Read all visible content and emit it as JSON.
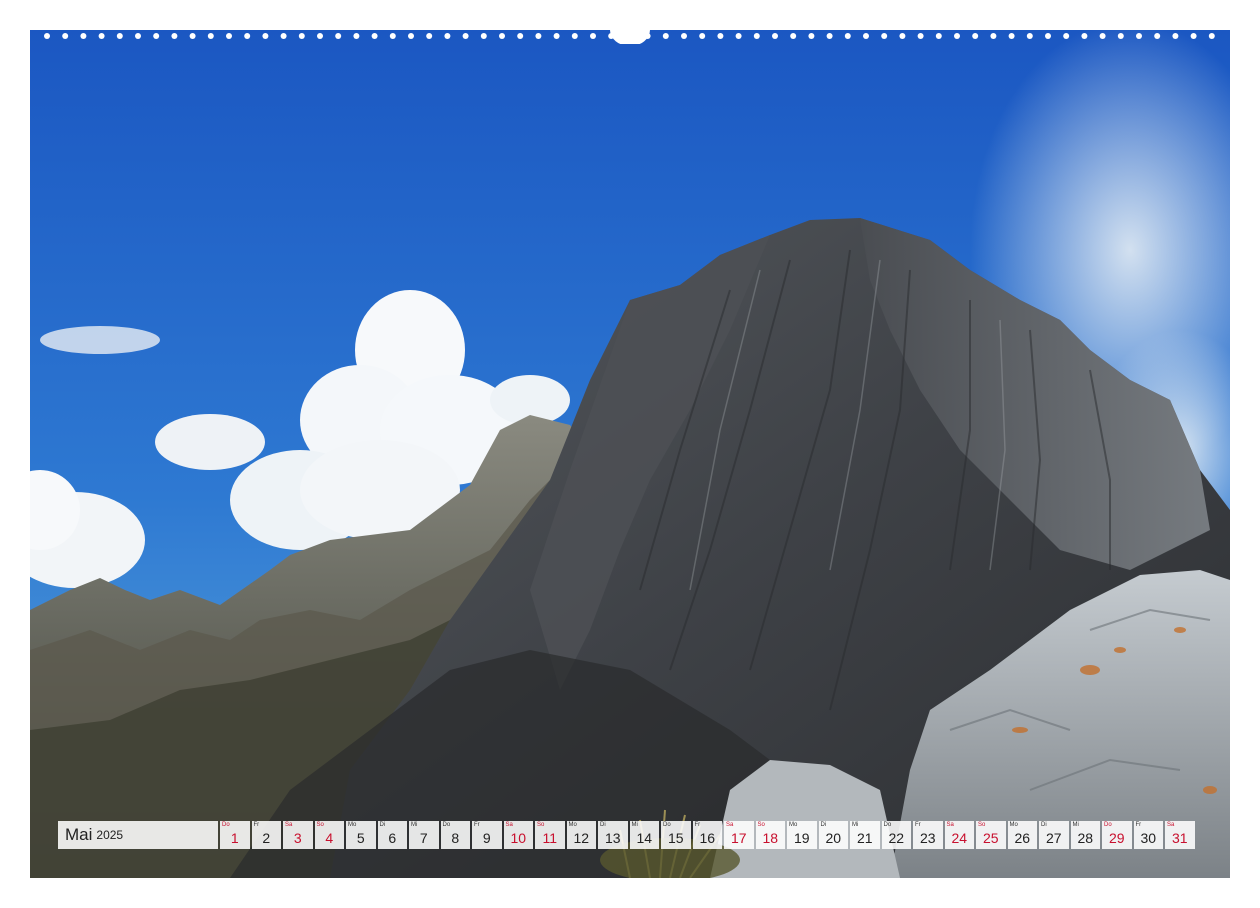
{
  "calendar": {
    "month": "Mai",
    "year": "2025",
    "days": [
      {
        "wd": "Do",
        "num": "1",
        "red": true
      },
      {
        "wd": "Fr",
        "num": "2",
        "red": false
      },
      {
        "wd": "Sa",
        "num": "3",
        "red": true
      },
      {
        "wd": "So",
        "num": "4",
        "red": true
      },
      {
        "wd": "Mo",
        "num": "5",
        "red": false
      },
      {
        "wd": "Di",
        "num": "6",
        "red": false
      },
      {
        "wd": "Mi",
        "num": "7",
        "red": false
      },
      {
        "wd": "Do",
        "num": "8",
        "red": false
      },
      {
        "wd": "Fr",
        "num": "9",
        "red": false
      },
      {
        "wd": "Sa",
        "num": "10",
        "red": true
      },
      {
        "wd": "So",
        "num": "11",
        "red": true
      },
      {
        "wd": "Mo",
        "num": "12",
        "red": false
      },
      {
        "wd": "Di",
        "num": "13",
        "red": false
      },
      {
        "wd": "Mi",
        "num": "14",
        "red": false
      },
      {
        "wd": "Do",
        "num": "15",
        "red": false
      },
      {
        "wd": "Fr",
        "num": "16",
        "red": false
      },
      {
        "wd": "Sa",
        "num": "17",
        "red": true
      },
      {
        "wd": "So",
        "num": "18",
        "red": true
      },
      {
        "wd": "Mo",
        "num": "19",
        "red": false
      },
      {
        "wd": "Di",
        "num": "20",
        "red": false
      },
      {
        "wd": "Mi",
        "num": "21",
        "red": false
      },
      {
        "wd": "Do",
        "num": "22",
        "red": false
      },
      {
        "wd": "Fr",
        "num": "23",
        "red": false
      },
      {
        "wd": "Sa",
        "num": "24",
        "red": true
      },
      {
        "wd": "So",
        "num": "25",
        "red": true
      },
      {
        "wd": "Mo",
        "num": "26",
        "red": false
      },
      {
        "wd": "Di",
        "num": "27",
        "red": false
      },
      {
        "wd": "Mi",
        "num": "28",
        "red": false
      },
      {
        "wd": "Do",
        "num": "29",
        "red": true
      },
      {
        "wd": "Fr",
        "num": "30",
        "red": false
      },
      {
        "wd": "Sa",
        "num": "31",
        "red": true
      }
    ]
  },
  "colors": {
    "sky_top": "#1c5cc6",
    "sky_bottom": "#4f9ad8",
    "rock_dark": "#3f4246",
    "rock_light": "#9a9fa3",
    "weekend_red": "#c8102e"
  },
  "scene": {
    "subject": "mountain-peak-photo",
    "binding_icon": "wire-binding-icon"
  }
}
